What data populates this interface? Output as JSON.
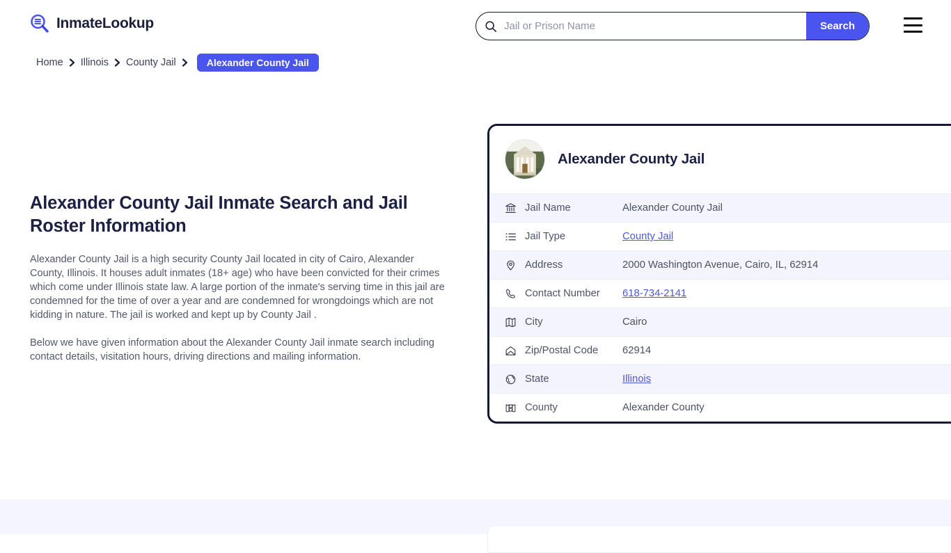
{
  "header": {
    "brand_name": "InmateLookup",
    "brand_icon": "magnifier-list-logo-icon",
    "search": {
      "icon": "search-icon",
      "placeholder": "Jail or Prison Name",
      "value": "",
      "button_label": "Search"
    },
    "menu_icon": "hamburger-menu-icon"
  },
  "breadcrumb": {
    "items": [
      {
        "label": "Home",
        "current": false
      },
      {
        "label": "Illinois",
        "current": false
      },
      {
        "label": "County Jail",
        "current": false
      },
      {
        "label": "Alexander County Jail",
        "current": true
      }
    ],
    "separator_icon": "chevron-right-icon"
  },
  "main": {
    "title": "Alexander County Jail Inmate Search and Jail Roster Information",
    "paragraph_1": "Alexander County Jail is a high security County Jail located in city of Cairo, Alexander County, Illinois. It houses adult inmates (18+ age) who have been convicted for their crimes which come under Illinois state law. A large portion of the inmate's serving time in this jail are condemned for the time of over a year and are condemned for wrongdoings which are not kidding in nature. The jail is worked and kept up by County Jail .",
    "paragraph_2": "Below we have given information about the Alexander County Jail inmate search including contact details, visitation hours, driving directions and mailing information."
  },
  "card": {
    "photo_alt": "alexander-county-jail-photo",
    "title": "Alexander County Jail",
    "rows": [
      {
        "icon": "bank-icon",
        "label": "Jail Name",
        "value": "Alexander County Jail",
        "link": false
      },
      {
        "icon": "list-icon",
        "label": "Jail Type",
        "value": "County Jail",
        "link": true
      },
      {
        "icon": "map-pin-icon",
        "label": "Address",
        "value": "2000 Washington Avenue, Cairo, IL, 62914",
        "link": false
      },
      {
        "icon": "phone-icon",
        "label": "Contact Number",
        "value": "618-734-2141",
        "link": true
      },
      {
        "icon": "map-icon",
        "label": "City",
        "value": "Cairo",
        "link": false
      },
      {
        "icon": "envelope-icon",
        "label": "Zip/Postal Code",
        "value": "62914",
        "link": false
      },
      {
        "icon": "globe-icon",
        "label": "State",
        "value": "Illinois",
        "link": true
      },
      {
        "icon": "map-marker-icon",
        "label": "County",
        "value": "Alexander County",
        "link": false
      }
    ]
  },
  "colors": {
    "accent": "#4a54ef",
    "card_border": "#141a33",
    "row_alt": "#f4f5fc",
    "band": "#f5f5fd",
    "heading": "#1c2143",
    "link": "#4b5ad6"
  }
}
